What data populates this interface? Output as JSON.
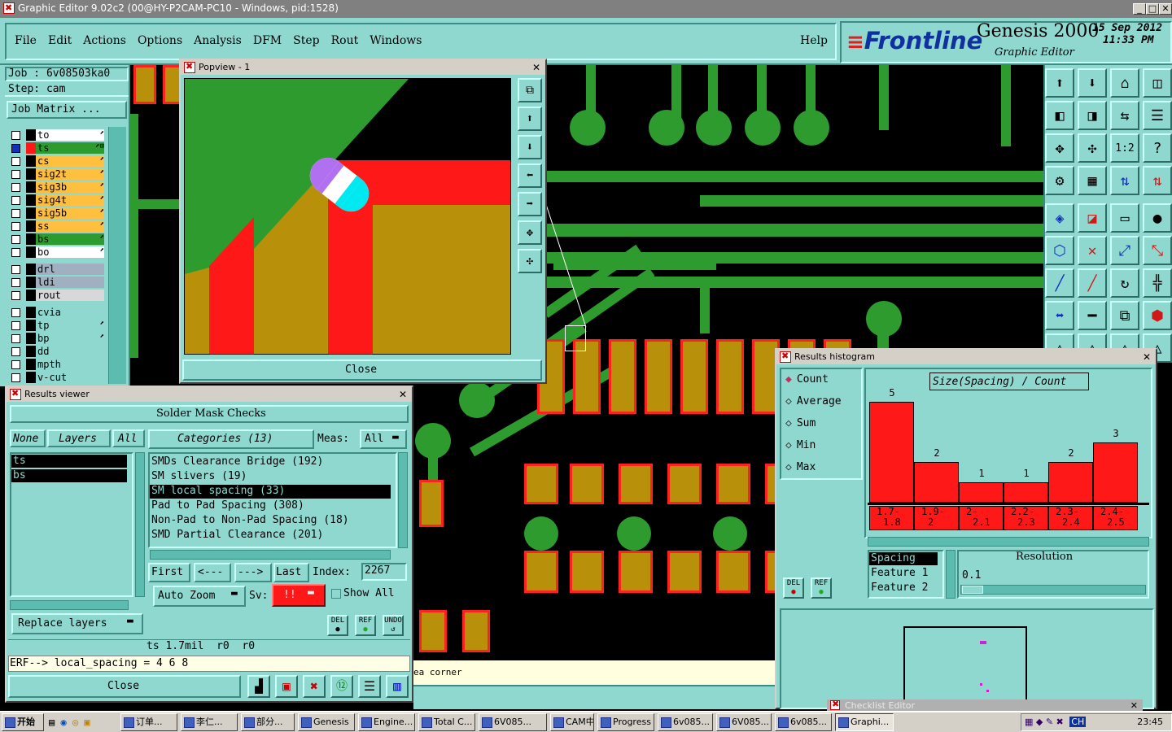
{
  "window": {
    "title": "Graphic Editor 9.02c2 (00@HY-P2CAM-PC10 - Windows, pid:1528)"
  },
  "menu": {
    "items": [
      "File",
      "Edit",
      "Actions",
      "Options",
      "Analysis",
      "DFM",
      "Step",
      "Rout",
      "Windows"
    ],
    "help": "Help"
  },
  "brand": {
    "logo": "Frontline",
    "product": "Genesis 2000",
    "subtitle": "Graphic Editor",
    "date": "15 Sep 2012",
    "time": "11:33 PM"
  },
  "job": {
    "job_label": "Job : 6v08503ka0",
    "step_label": "Step: cam",
    "matrix_button": "Job Matrix ..."
  },
  "layers": [
    {
      "name": "to",
      "color": "#ffffff",
      "mark": "⬈"
    },
    {
      "name": "ts",
      "color": "#2e9b2e",
      "mark": "⬈⊞"
    },
    {
      "name": "cs",
      "color": "#ffc040",
      "mark": "⬈"
    },
    {
      "name": "sig2t",
      "color": "#ffc040",
      "mark": "⬈"
    },
    {
      "name": "sig3b",
      "color": "#ffc040",
      "mark": "⬈"
    },
    {
      "name": "sig4t",
      "color": "#ffc040",
      "mark": "⬈"
    },
    {
      "name": "sig5b",
      "color": "#ffc040",
      "mark": "⬈"
    },
    {
      "name": "ss",
      "color": "#ffc040",
      "mark": "⬈"
    },
    {
      "name": "bs",
      "color": "#2e9b2e",
      "mark": "⬈"
    },
    {
      "name": "bo",
      "color": "#ffffff",
      "mark": "⬈"
    },
    {
      "name": "drl",
      "color": "#a0b0c0",
      "mark": ""
    },
    {
      "name": "ldi",
      "color": "#a0b0c0",
      "mark": ""
    },
    {
      "name": "rout",
      "color": "#d8d8d8",
      "mark": ""
    },
    {
      "name": "cvia",
      "color": "#8fd8d0",
      "mark": ""
    },
    {
      "name": "tp",
      "color": "#8fd8d0",
      "mark": "⬈"
    },
    {
      "name": "bp",
      "color": "#8fd8d0",
      "mark": "⬈"
    },
    {
      "name": "dd",
      "color": "#8fd8d0",
      "mark": ""
    },
    {
      "name": "mpth",
      "color": "#8fd8d0",
      "mark": ""
    },
    {
      "name": "v-cut",
      "color": "#8fd8d0",
      "mark": ""
    }
  ],
  "popview": {
    "title": "Popview - 1",
    "close": "Close",
    "close_x": "✕"
  },
  "results_viewer": {
    "title": "Results viewer",
    "heading": "Solder Mask Checks",
    "none": "None",
    "layers": "Layers",
    "all": "All",
    "categories_btn": "Categories (13)",
    "meas_label": "Meas:",
    "meas_value": "All",
    "layer_list": [
      "ts",
      "bs"
    ],
    "categories": [
      "SMDs Clearance Bridge (192)",
      "SM slivers (19)",
      "SM local spacing (33)",
      "Pad to Pad Spacing (308)",
      "Non-Pad to Non-Pad Spacing (18)",
      "SMD Partial Clearance (201)"
    ],
    "selected_category": 2,
    "nav": {
      "first": "First",
      "prev": "<---",
      "next": "--->",
      "last": "Last",
      "index_label": "Index:",
      "index_value": "2267"
    },
    "auto_zoom": "Auto Zoom",
    "sv_label": "Sv:",
    "sv_value": "!!",
    "show_all": "Show All",
    "replace_layers": "Replace layers",
    "status_line": "ts 1.7mil  r0  r0",
    "erf_line": "ERF--> local_spacing = 4 6 8",
    "close": "Close",
    "del": "DEL",
    "ref": "REF",
    "undo": "UNDO"
  },
  "histogram": {
    "title": "Results histogram",
    "radios": [
      "Count",
      "Average",
      "Sum",
      "Min",
      "Max"
    ],
    "selected_radio": 0,
    "chart_title": "Size(Spacing) / Count",
    "bins": [
      "1.7-1.8",
      "1.9-2",
      "2-2.1",
      "2.2-2.3",
      "2.3-2.4",
      "2.4-2.5"
    ],
    "bin_top": [
      "1.7-",
      "1.9-",
      "2-",
      "2.2-",
      "2.3-",
      "2.4-"
    ],
    "bin_bottom": [
      "1.8",
      "2",
      "2.1",
      "2.3",
      "2.4",
      "2.5"
    ],
    "counts": [
      5,
      2,
      1,
      1,
      2,
      3
    ],
    "fields": [
      "Spacing",
      "Feature 1",
      "Feature 2"
    ],
    "resolution_label": "Resolution",
    "resolution_value": "0.1",
    "del": "DEL",
    "ref": "REF"
  },
  "chart_data": {
    "type": "bar",
    "title": "Size(Spacing) / Count",
    "categories": [
      "1.7-1.8",
      "1.9-2",
      "2-2.1",
      "2.2-2.3",
      "2.3-2.4",
      "2.4-2.5"
    ],
    "values": [
      5,
      2,
      1,
      1,
      2,
      3
    ],
    "xlabel": "",
    "ylabel": ""
  },
  "status_strip": {
    "text": "ea corner"
  },
  "checklist": {
    "title": "Checklist Editor"
  },
  "taskbar": {
    "start": "开始",
    "items": [
      "订单...",
      "李仁...",
      "部分...",
      "Genesis",
      "Engine...",
      "Total C...",
      "6V085...",
      "CAM中...",
      "Progress",
      "6v085...",
      "6V085...",
      "6v085...",
      "Graphi..."
    ],
    "clock": "23:45",
    "ime": "CH"
  }
}
